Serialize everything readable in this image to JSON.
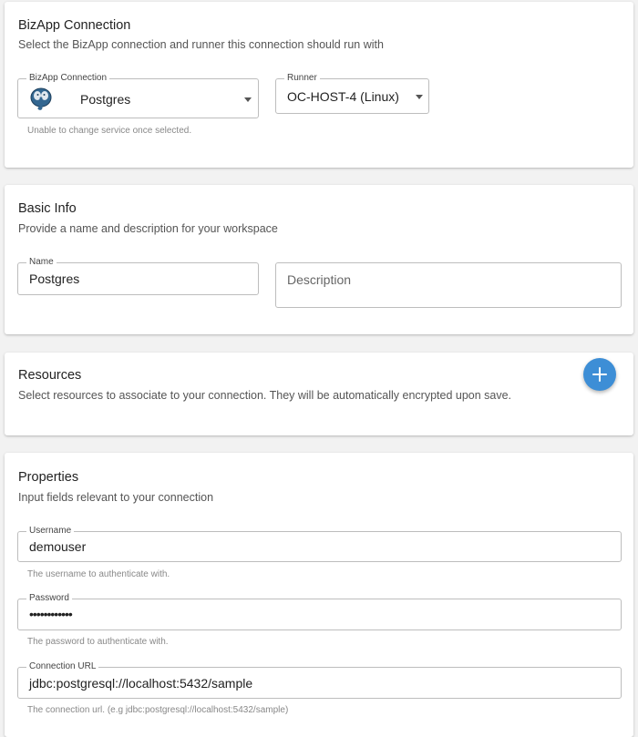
{
  "bizapp_card": {
    "title": "BizApp Connection",
    "subtitle": "Select the BizApp connection and runner this connection should run with",
    "connection": {
      "label": "BizApp Connection",
      "value": "Postgres",
      "icon": "postgres-elephant-icon",
      "helper": "Unable to change service once selected."
    },
    "runner": {
      "label": "Runner",
      "value": "OC-HOST-4 (Linux)"
    }
  },
  "basic_info_card": {
    "title": "Basic Info",
    "subtitle": "Provide a name and description for your workspace",
    "name": {
      "label": "Name",
      "value": "Postgres"
    },
    "description": {
      "placeholder": "Description",
      "value": ""
    }
  },
  "resources_card": {
    "title": "Resources",
    "subtitle": "Select resources to associate to your connection. They will be automatically encrypted upon save.",
    "add_icon": "plus-icon",
    "accent_color": "#3d8ed6"
  },
  "properties_card": {
    "title": "Properties",
    "subtitle": "Input fields relevant to your connection",
    "fields": [
      {
        "label": "Username",
        "value": "demouser",
        "helper": "The username to authenticate with."
      },
      {
        "label": "Password",
        "value": "••••••••••••",
        "helper": "The password to authenticate with."
      },
      {
        "label": "Connection URL",
        "value": "jdbc:postgresql://localhost:5432/sample",
        "helper": "The connection url. (e.g jdbc:postgresql://localhost:5432/sample)"
      }
    ]
  }
}
